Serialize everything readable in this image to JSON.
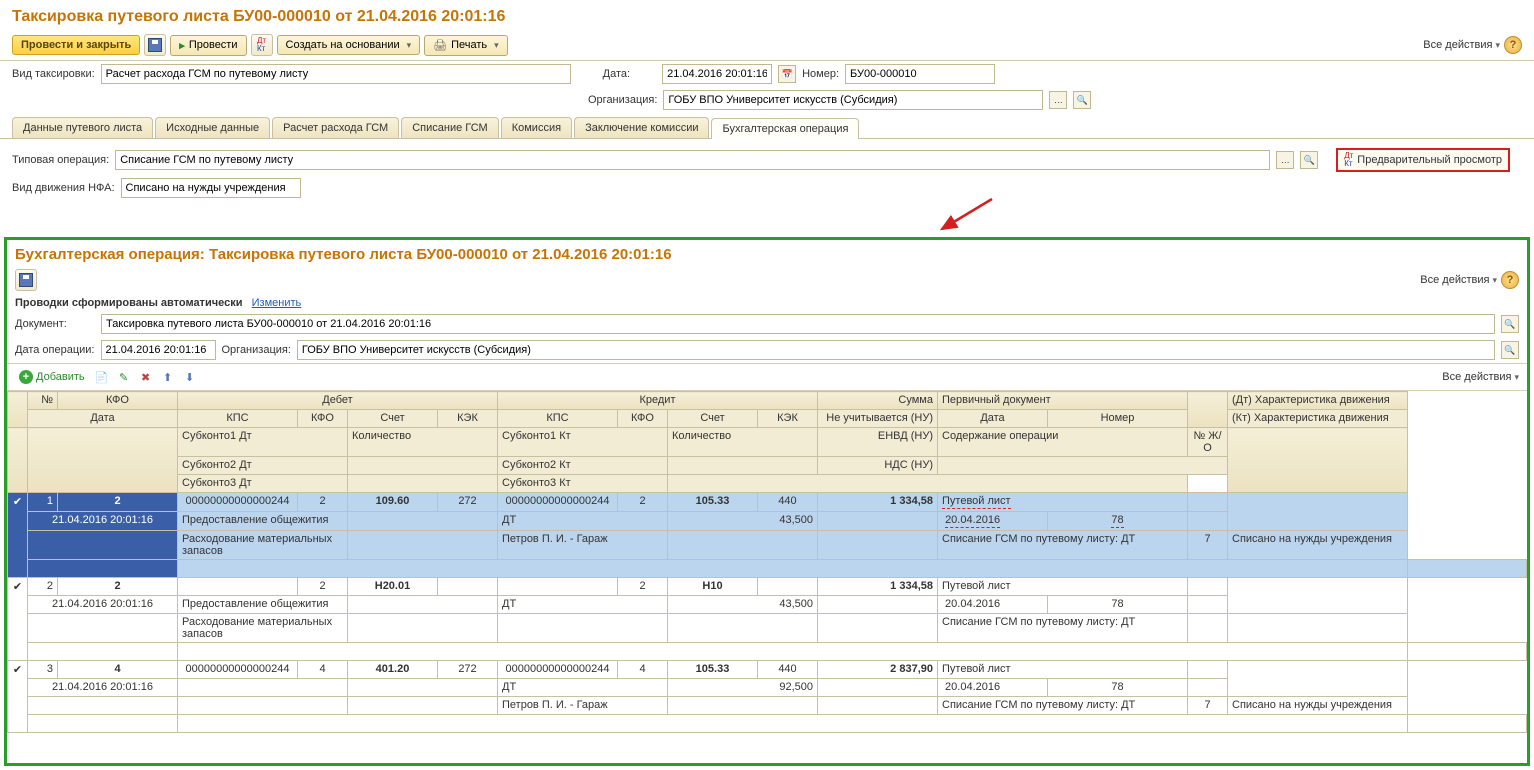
{
  "title": "Таксировка путевого листа БУ00-000010 от 21.04.2016 20:01:16",
  "toolbar": {
    "post_close": "Провести и закрыть",
    "post": "Провести",
    "create_based": "Создать на основании",
    "print": "Печать",
    "all_actions": "Все действия"
  },
  "fields": {
    "taxi_type_label": "Вид таксировки:",
    "taxi_type_value": "Расчет расхода ГСМ по путевому листу",
    "date_label": "Дата:",
    "date_value": "21.04.2016 20:01:16",
    "number_label": "Номер:",
    "number_value": "БУ00-000010",
    "org_label": "Организация:",
    "org_value": "ГОБУ ВПО Университет искусств (Субсидия)",
    "typical_op_label": "Типовая операция:",
    "typical_op_value": "Списание ГСМ по путевому листу",
    "nfa_label": "Вид движения НФА:",
    "nfa_value": "Списано на нужды учреждения",
    "preview_btn": "Предварительный просмотр"
  },
  "tabs": [
    "Данные путевого листа",
    "Исходные данные",
    "Расчет расхода ГСМ",
    "Списание ГСМ",
    "Комиссия",
    "Заключение комиссии",
    "Бухгалтерская операция"
  ],
  "active_tab": 6,
  "panel": {
    "title": "Бухгалтерская операция: Таксировка путевого листа БУ00-000010 от 21.04.2016 20:01:16",
    "auto_text": "Проводки сформированы автоматически",
    "change_link": "Изменить",
    "doc_label": "Документ:",
    "doc_value": "Таксировка путевого листа БУ00-000010 от 21.04.2016 20:01:16",
    "op_date_label": "Дата операции:",
    "op_date_value": "21.04.2016 20:01:16",
    "org_label": "Организация:",
    "org_value": "ГОБУ ВПО Университет искусств (Субсидия)",
    "add_btn": "Добавить",
    "all_actions": "Все действия"
  },
  "grid": {
    "h_num": "№",
    "h_kfo": "КФО",
    "h_debit": "Дебет",
    "h_credit": "Кредит",
    "h_sum": "Сумма",
    "h_prim": "Первичный документ",
    "h_dt_char": "(Дт) Характеристика движения",
    "h_date": "Дата",
    "h_kps": "КПС",
    "h_kfo2": "КФО",
    "h_acc": "Счет",
    "h_kek": "КЭК",
    "h_nu": "Не учитывается (НУ)",
    "h_pdate": "Дата",
    "h_pnum": "Номер",
    "h_kt_char": "(Кт) Характеристика движения",
    "h_sub1d": "Субконто1 Дт",
    "h_qty": "Количество",
    "h_sub1k": "Субконто1 Кт",
    "h_qty2": "Количество",
    "h_envd": "ЕНВД (НУ)",
    "h_content": "Содержание операции",
    "h_jo": "№ Ж/О",
    "h_sub2d": "Субконто2 Дт",
    "h_sub2k": "Субконто2 Кт",
    "h_nds": "НДС (НУ)",
    "h_sub3d": "Субконто3 Дт",
    "h_sub3k": "Субконто3 Кт",
    "rows": [
      {
        "n": "1",
        "kfo": "2",
        "date": "21.04.2016 20:01:16",
        "d_kps": "00000000000000244",
        "d_kfo": "2",
        "d_acc": "109.60",
        "d_kek": "272",
        "d_s1": "Предоставление общежития",
        "d_s2": "Расходование материальных запасов",
        "k_kps": "00000000000000244",
        "k_kfo": "2",
        "k_acc": "105.33",
        "k_kek": "440",
        "k_s1": "ДТ",
        "k_qty": "43,500",
        "k_s2": "Петров П. И. - Гараж",
        "sum": "1 334,58",
        "prim": "Путевой лист",
        "pdate": "20.04.2016",
        "pnum": "78",
        "content": "Списание ГСМ по путевому листу: ДТ",
        "jo": "7",
        "char": "Списано на нужды учреждения",
        "sel": true
      },
      {
        "n": "2",
        "kfo": "2",
        "date": "21.04.2016 20:01:16",
        "d_kps": "",
        "d_kfo": "2",
        "d_acc": "Н20.01",
        "d_kek": "",
        "d_s1": "Предоставление общежития",
        "d_s2": "Расходование материальных запасов",
        "k_kps": "",
        "k_kfo": "2",
        "k_acc": "Н10",
        "k_kek": "",
        "k_s1": "ДТ",
        "k_qty": "43,500",
        "k_s2": "",
        "sum": "1 334,58",
        "prim": "Путевой лист",
        "pdate": "20.04.2016",
        "pnum": "78",
        "content": "Списание ГСМ по путевому листу: ДТ",
        "jo": "",
        "char": ""
      },
      {
        "n": "3",
        "kfo": "4",
        "date": "21.04.2016 20:01:16",
        "d_kps": "00000000000000244",
        "d_kfo": "4",
        "d_acc": "401.20",
        "d_kek": "272",
        "d_s1": "",
        "d_s2": "",
        "k_kps": "00000000000000244",
        "k_kfo": "4",
        "k_acc": "105.33",
        "k_kek": "440",
        "k_s1": "ДТ",
        "k_qty": "92,500",
        "k_s2": "Петров П. И. - Гараж",
        "sum": "2 837,90",
        "prim": "Путевой лист",
        "pdate": "20.04.2016",
        "pnum": "78",
        "content": "Списание ГСМ по путевому листу: ДТ",
        "jo": "7",
        "char": "Списано на нужды учреждения"
      }
    ]
  }
}
